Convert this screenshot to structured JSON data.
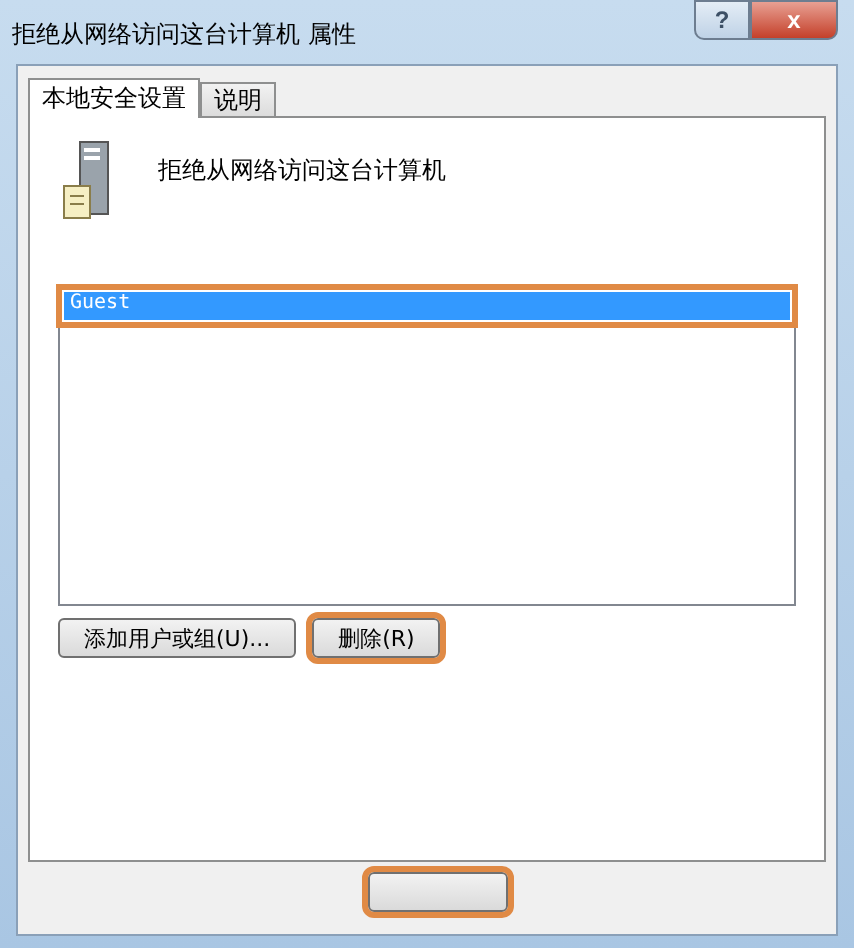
{
  "window": {
    "title": "拒绝从网络访问这台计算机 属性",
    "buttons": [
      {
        "kind": "help",
        "label": "?"
      },
      {
        "kind": "close",
        "label": "x"
      }
    ]
  },
  "tabs": [
    {
      "label": "本地安全设置",
      "selected": true
    },
    {
      "label": "说明",
      "selected": false
    }
  ],
  "policy": {
    "name": "拒绝从网络访问这台计算机"
  },
  "accounts": [
    {
      "name": "Guest",
      "selected": true,
      "highlighted": true
    }
  ],
  "actions": [
    {
      "label": "添加用户或组(U)...",
      "highlighted": false
    },
    {
      "label": "删除(R)",
      "highlighted": true
    }
  ],
  "footer_buttons": [
    {
      "highlighted": true
    }
  ]
}
